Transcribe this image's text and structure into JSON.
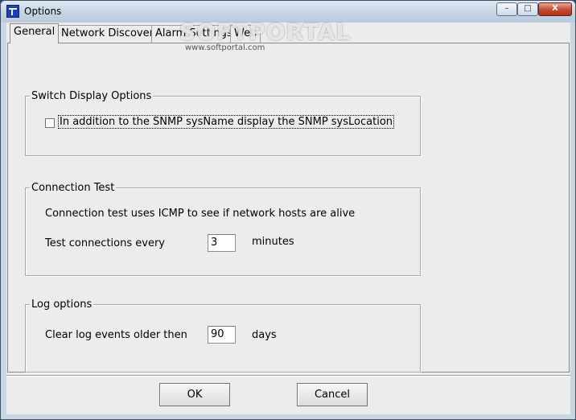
{
  "window": {
    "title": "Options",
    "controls": {
      "minimize": "–",
      "maximize": "□",
      "close": "X"
    }
  },
  "tabs": [
    {
      "label": "General",
      "active": true
    },
    {
      "label": "Network Discovery",
      "active": false
    },
    {
      "label": "Alarm Settings",
      "active": false
    },
    {
      "label": "Web",
      "active": false
    }
  ],
  "switch_display": {
    "legend": "Switch Display Options",
    "checkbox_label": "In addition to the SNMP sysName display the SNMP sysLocation",
    "checked": false
  },
  "connection_test": {
    "legend": "Connection Test",
    "description": "Connection test uses ICMP to see if network hosts are alive",
    "interval_label": "Test connections every",
    "interval_value": "3",
    "interval_unit": "minutes"
  },
  "log_options": {
    "legend": "Log options",
    "clear_label": "Clear log events older then",
    "clear_value": "90",
    "clear_unit": "days"
  },
  "buttons": {
    "ok": "OK",
    "cancel": "Cancel"
  },
  "watermark": {
    "text": "SOFTPORTAL",
    "url": "www.softportal.com"
  }
}
